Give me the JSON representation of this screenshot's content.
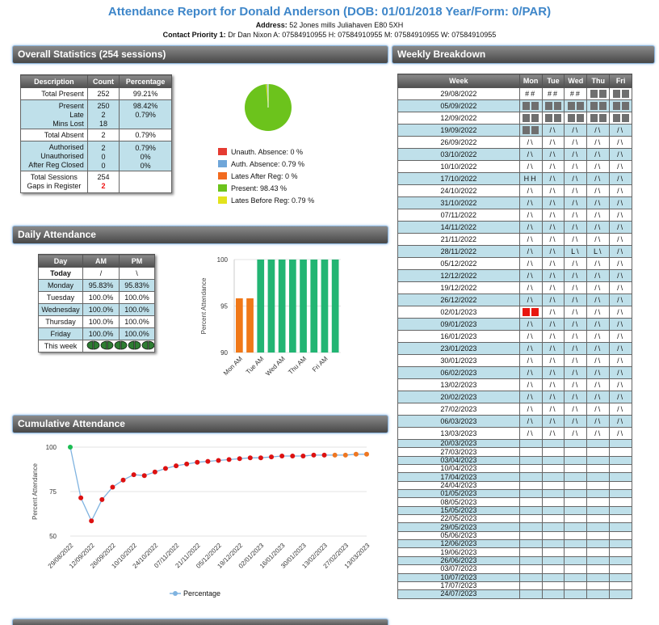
{
  "page": {
    "title": "Attendance Report for Donald Anderson (DOB: 01/01/2018 Year/Form: 0/PAR)",
    "address_label": "Address:",
    "address": "52 Jones mills Juliahaven E80 5XH",
    "contact_label": "Contact Priority 1:",
    "contact": "Dr Dan Nixon A: 07584910955 H: 07584910955 M: 07584910955 W: 07584910955"
  },
  "overall": {
    "header": "Overall Statistics (254 sessions)",
    "columns": [
      "Description",
      "Count",
      "Percentage"
    ],
    "total_present": [
      "Total Present",
      "252",
      "99.21%"
    ],
    "present": [
      "Present",
      "250",
      "98.42%"
    ],
    "late": [
      "Late",
      "2",
      "0.79%"
    ],
    "mins_lost": [
      "Mins Lost",
      "18",
      ""
    ],
    "total_absent": [
      "Total Absent",
      "2",
      "0.79%"
    ],
    "authorised": [
      "Authorised",
      "2",
      "0.79%"
    ],
    "unauthorised": [
      "Unauthorised",
      "0",
      "0%"
    ],
    "after_reg": [
      "After Reg Closed",
      "0",
      "0%"
    ],
    "total_sessions": [
      "Total Sessions",
      "254"
    ],
    "gaps": [
      "Gaps in Register",
      "2"
    ]
  },
  "pie_legend": [
    {
      "label": "Unauth. Absence: 0 %",
      "color": "#e53b32"
    },
    {
      "label": "Auth. Absence: 0.79 %",
      "color": "#6fa6d9"
    },
    {
      "label": "Lates After Reg: 0 %",
      "color": "#f26b1f"
    },
    {
      "label": "Present: 98.43 %",
      "color": "#6cc31c"
    },
    {
      "label": "Lates Before Reg: 0.79 %",
      "color": "#e3e31c"
    }
  ],
  "pie_data": {
    "present": 98.43,
    "late_before": 0.79,
    "auth": 0.79
  },
  "daily": {
    "header": "Daily Attendance",
    "columns": [
      "Day",
      "AM",
      "PM"
    ],
    "rows": [
      [
        "Today",
        "/",
        "\\"
      ],
      [
        "Monday",
        "95.83%",
        "95.83%"
      ],
      [
        "Tuesday",
        "100.0%",
        "100.0%"
      ],
      [
        "Wednesday",
        "100.0%",
        "100.0%"
      ],
      [
        "Thursday",
        "100.0%",
        "100.0%"
      ],
      [
        "Friday",
        "100.0%",
        "100.0%"
      ]
    ],
    "this_week": "This week"
  },
  "chart_data": [
    {
      "type": "bar",
      "categories": [
        "Mon AM",
        "Mon PM",
        "Tue AM",
        "Tue PM",
        "Wed AM",
        "Wed PM",
        "Thu AM",
        "Thu PM",
        "Fri AM",
        "Fri PM"
      ],
      "tick_labels": [
        "Mon AM",
        "Tue AM",
        "Wed AM",
        "Thu AM",
        "Fri AM"
      ],
      "values": [
        95.83,
        95.83,
        100,
        100,
        100,
        100,
        100,
        100,
        100,
        100
      ],
      "colors": [
        "#f07818",
        "#f07818",
        "#22b573",
        "#22b573",
        "#22b573",
        "#22b573",
        "#22b573",
        "#22b573",
        "#22b573",
        "#22b573"
      ],
      "ylabel": "Percent Attendance",
      "ylim": [
        90,
        100
      ],
      "yticks": [
        90,
        95,
        100
      ]
    },
    {
      "type": "line",
      "x": [
        "29/08/2022",
        "05/09/2022",
        "12/09/2022",
        "19/09/2022",
        "26/09/2022",
        "03/10/2022",
        "10/10/2022",
        "17/10/2022",
        "24/10/2022",
        "31/10/2022",
        "07/11/2022",
        "14/11/2022",
        "21/11/2022",
        "28/11/2022",
        "05/12/2022",
        "12/12/2022",
        "19/12/2022",
        "26/12/2022",
        "02/01/2023",
        "09/01/2023",
        "16/01/2023",
        "23/01/2023",
        "30/01/2023",
        "06/02/2023",
        "13/02/2023",
        "20/02/2023",
        "27/02/2023",
        "06/03/2023",
        "13/03/2023"
      ],
      "tick_labels": [
        "29/08/2022",
        "12/09/2022",
        "26/09/2022",
        "10/10/2022",
        "24/10/2022",
        "07/11/2022",
        "21/11/2022",
        "05/12/2022",
        "19/12/2022",
        "02/01/2023",
        "16/01/2023",
        "30/01/2023",
        "13/02/2023",
        "27/02/2023",
        "13/03/2023"
      ],
      "series": [
        {
          "name": "Percentage",
          "values": [
            100,
            71.5,
            58.5,
            70.5,
            77.5,
            81.5,
            84.5,
            84,
            86,
            88,
            89.5,
            90.5,
            91.5,
            92,
            92.5,
            93,
            93.5,
            94,
            94,
            94.5,
            95,
            95,
            95,
            95.5,
            95.5,
            95.5,
            95.5,
            96,
            96
          ]
        }
      ],
      "point_colors": [
        "#1bbd53",
        "#dd1111",
        "#dd1111",
        "#dd1111",
        "#dd1111",
        "#dd1111",
        "#dd1111",
        "#dd1111",
        "#dd1111",
        "#dd1111",
        "#dd1111",
        "#dd1111",
        "#dd1111",
        "#dd1111",
        "#dd1111",
        "#dd1111",
        "#dd1111",
        "#dd1111",
        "#dd1111",
        "#dd1111",
        "#dd1111",
        "#dd1111",
        "#dd1111",
        "#dd1111",
        "#dd1111",
        "#ee7722",
        "#ee7722",
        "#ee7722",
        "#ee7722"
      ],
      "ylabel": "Percent Attendance",
      "ylim": [
        50,
        100
      ],
      "yticks": [
        50,
        75,
        100
      ]
    }
  ],
  "cumulative": {
    "header": "Cumulative Attendance"
  },
  "weekly": {
    "header": "Weekly Breakdown",
    "columns": [
      "Week",
      "Mon",
      "Tue",
      "Wed",
      "Thu",
      "Fri"
    ],
    "rows": [
      [
        "29/08/2022",
        "##",
        "##",
        "##",
        "G",
        "G"
      ],
      [
        "05/09/2022",
        "G",
        "G",
        "G",
        "G",
        "G"
      ],
      [
        "12/09/2022",
        "G",
        "G",
        "G",
        "G",
        "G"
      ],
      [
        "19/09/2022",
        "G",
        "/\\",
        "/\\",
        "/\\",
        "/\\"
      ],
      [
        "26/09/2022",
        "/\\",
        "/\\",
        "/\\",
        "/\\",
        "/\\"
      ],
      [
        "03/10/2022",
        "/\\",
        "/\\",
        "/\\",
        "/\\",
        "/\\"
      ],
      [
        "10/10/2022",
        "/\\",
        "/\\",
        "/\\",
        "/\\",
        "/\\"
      ],
      [
        "17/10/2022",
        "HH",
        "/\\",
        "/\\",
        "/\\",
        "/\\"
      ],
      [
        "24/10/2022",
        "/\\",
        "/\\",
        "/\\",
        "/\\",
        "/\\"
      ],
      [
        "31/10/2022",
        "/\\",
        "/\\",
        "/\\",
        "/\\",
        "/\\"
      ],
      [
        "07/11/2022",
        "/\\",
        "/\\",
        "/\\",
        "/\\",
        "/\\"
      ],
      [
        "14/11/2022",
        "/\\",
        "/\\",
        "/\\",
        "/\\",
        "/\\"
      ],
      [
        "21/11/2022",
        "/\\",
        "/\\",
        "/\\",
        "/\\",
        "/\\"
      ],
      [
        "28/11/2022",
        "/\\",
        "/\\",
        "L\\",
        "L\\",
        "/\\"
      ],
      [
        "05/12/2022",
        "/\\",
        "/\\",
        "/\\",
        "/\\",
        "/\\"
      ],
      [
        "12/12/2022",
        "/\\",
        "/\\",
        "/\\",
        "/\\",
        "/\\"
      ],
      [
        "19/12/2022",
        "/\\",
        "/\\",
        "/\\",
        "/\\",
        "/\\"
      ],
      [
        "26/12/2022",
        "/\\",
        "/\\",
        "/\\",
        "/\\",
        "/\\"
      ],
      [
        "02/01/2023",
        "R",
        "/\\",
        "/\\",
        "/\\",
        "/\\"
      ],
      [
        "09/01/2023",
        "/\\",
        "/\\",
        "/\\",
        "/\\",
        "/\\"
      ],
      [
        "16/01/2023",
        "/\\",
        "/\\",
        "/\\",
        "/\\",
        "/\\"
      ],
      [
        "23/01/2023",
        "/\\",
        "/\\",
        "/\\",
        "/\\",
        "/\\"
      ],
      [
        "30/01/2023",
        "/\\",
        "/\\",
        "/\\",
        "/\\",
        "/\\"
      ],
      [
        "06/02/2023",
        "/\\",
        "/\\",
        "/\\",
        "/\\",
        "/\\"
      ],
      [
        "13/02/2023",
        "/\\",
        "/\\",
        "/\\",
        "/\\",
        "/\\"
      ],
      [
        "20/02/2023",
        "/\\",
        "/\\",
        "/\\",
        "/\\",
        "/\\"
      ],
      [
        "27/02/2023",
        "/\\",
        "/\\",
        "/\\",
        "/\\",
        "/\\"
      ],
      [
        "06/03/2023",
        "/\\",
        "/\\",
        "/\\",
        "/\\",
        "/\\"
      ],
      [
        "13/03/2023",
        "/\\",
        "/\\",
        "/\\",
        "/\\",
        "/\\"
      ],
      [
        "20/03/2023",
        "",
        "",
        "",
        "",
        ""
      ],
      [
        "27/03/2023",
        "",
        "",
        "",
        "",
        ""
      ],
      [
        "03/04/2023",
        "",
        "",
        "",
        "",
        ""
      ],
      [
        "10/04/2023",
        "",
        "",
        "",
        "",
        ""
      ],
      [
        "17/04/2023",
        "",
        "",
        "",
        "",
        ""
      ],
      [
        "24/04/2023",
        "",
        "",
        "",
        "",
        ""
      ],
      [
        "01/05/2023",
        "",
        "",
        "",
        "",
        ""
      ],
      [
        "08/05/2023",
        "",
        "",
        "",
        "",
        ""
      ],
      [
        "15/05/2023",
        "",
        "",
        "",
        "",
        ""
      ],
      [
        "22/05/2023",
        "",
        "",
        "",
        "",
        ""
      ],
      [
        "29/05/2023",
        "",
        "",
        "",
        "",
        ""
      ],
      [
        "05/06/2023",
        "",
        "",
        "",
        "",
        ""
      ],
      [
        "12/06/2023",
        "",
        "",
        "",
        "",
        ""
      ],
      [
        "19/06/2023",
        "",
        "",
        "",
        "",
        ""
      ],
      [
        "26/06/2023",
        "",
        "",
        "",
        "",
        ""
      ],
      [
        "03/07/2023",
        "",
        "",
        "",
        "",
        ""
      ],
      [
        "10/07/2023",
        "",
        "",
        "",
        "",
        ""
      ],
      [
        "17/07/2023",
        "",
        "",
        "",
        "",
        ""
      ],
      [
        "24/07/2023",
        "",
        "",
        "",
        "",
        ""
      ]
    ]
  }
}
